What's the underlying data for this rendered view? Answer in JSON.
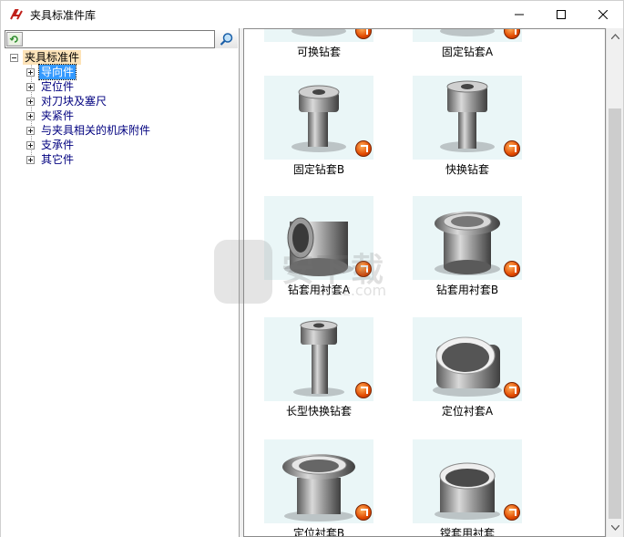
{
  "window": {
    "title": "夹具标准件库"
  },
  "search": {
    "value": "",
    "placeholder": ""
  },
  "tree": {
    "root": "夹具标准件",
    "items": [
      {
        "label": "导向件",
        "selected": true
      },
      {
        "label": "定位件",
        "selected": false
      },
      {
        "label": "对刀块及塞尺",
        "selected": false
      },
      {
        "label": "夹紧件",
        "selected": false
      },
      {
        "label": "与夹具相关的机床附件",
        "selected": false
      },
      {
        "label": "支承件",
        "selected": false
      },
      {
        "label": "其它件",
        "selected": false
      }
    ]
  },
  "gallery": {
    "items": [
      {
        "label": "可换钻套",
        "shape": "bushing-head"
      },
      {
        "label": "固定钻套A",
        "shape": "plain-bushing"
      },
      {
        "label": "固定钻套B",
        "shape": "collar-bushing"
      },
      {
        "label": "快换钻套",
        "shape": "quick-change-bushing"
      },
      {
        "label": "钻套用衬套A",
        "shape": "sleeve"
      },
      {
        "label": "钻套用衬套B",
        "shape": "flanged-sleeve"
      },
      {
        "label": "长型快换钻套",
        "shape": "long-quick-bushing"
      },
      {
        "label": "定位衬套A",
        "shape": "ring"
      },
      {
        "label": "定位衬套B",
        "shape": "flanged-ring"
      },
      {
        "label": "镗套用衬套",
        "shape": "short-ring"
      }
    ]
  },
  "colors": {
    "selection": "#3399ff",
    "root_highlight": "#fde3b8",
    "tree_text": "#00007f",
    "thumb_bg": "#eaf6f7",
    "badge": "#e24a00"
  },
  "watermark_text": "安下载",
  "watermark_sub": "anxz.com"
}
